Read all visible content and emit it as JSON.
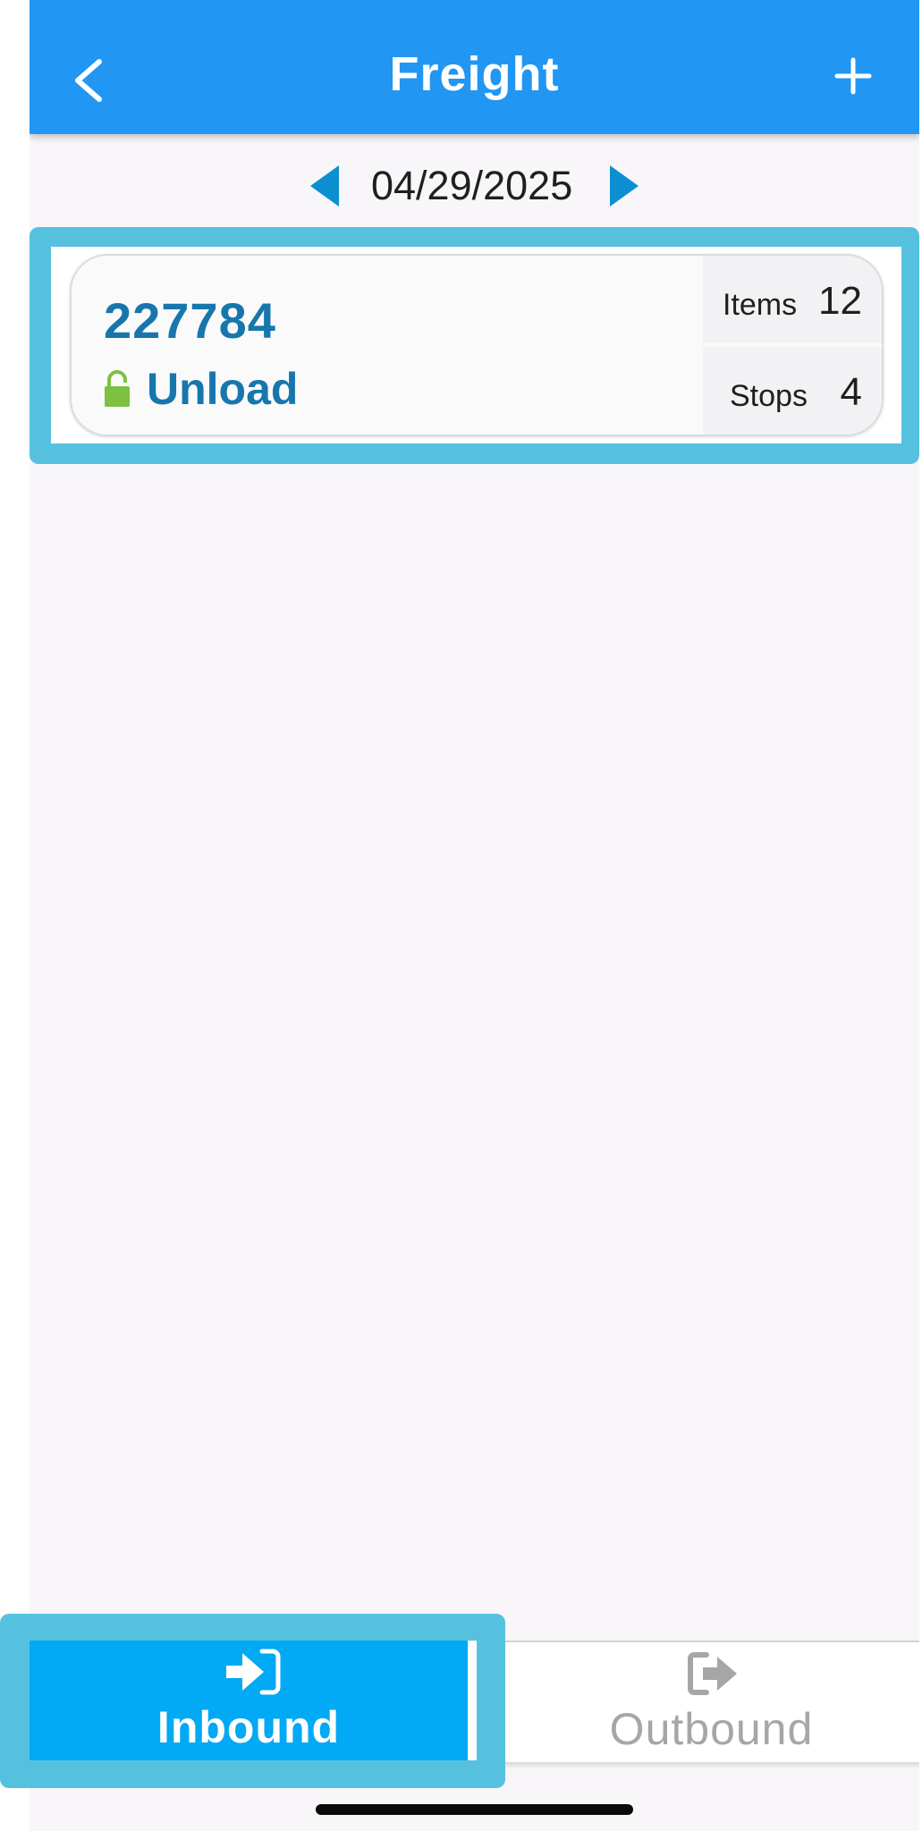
{
  "header": {
    "title": "Freight",
    "back_icon": "chevron-left-icon",
    "add_icon": "plus-icon",
    "background_color": "#2196f3"
  },
  "date_selector": {
    "value": "04/29/2025",
    "prev_icon": "triangle-left-icon",
    "next_icon": "triangle-right-icon",
    "arrow_color": "#0b8fd1"
  },
  "freight_list": [
    {
      "number": "227784",
      "status": "Unload",
      "status_icon": "unlocked-padlock-icon",
      "status_icon_color": "#7cc142",
      "items_label": "Items",
      "items_value": "12",
      "stops_label": "Stops",
      "stops_value": "4",
      "text_color": "#1777ac"
    }
  ],
  "tabs": {
    "inbound": {
      "label": "Inbound",
      "icon": "sign-in-icon",
      "selected": true,
      "color": "#02a9f4"
    },
    "outbound": {
      "label": "Outbound",
      "icon": "sign-out-icon",
      "selected": false,
      "color": "#a6a6a6"
    }
  },
  "highlight_color": "#56c1df"
}
